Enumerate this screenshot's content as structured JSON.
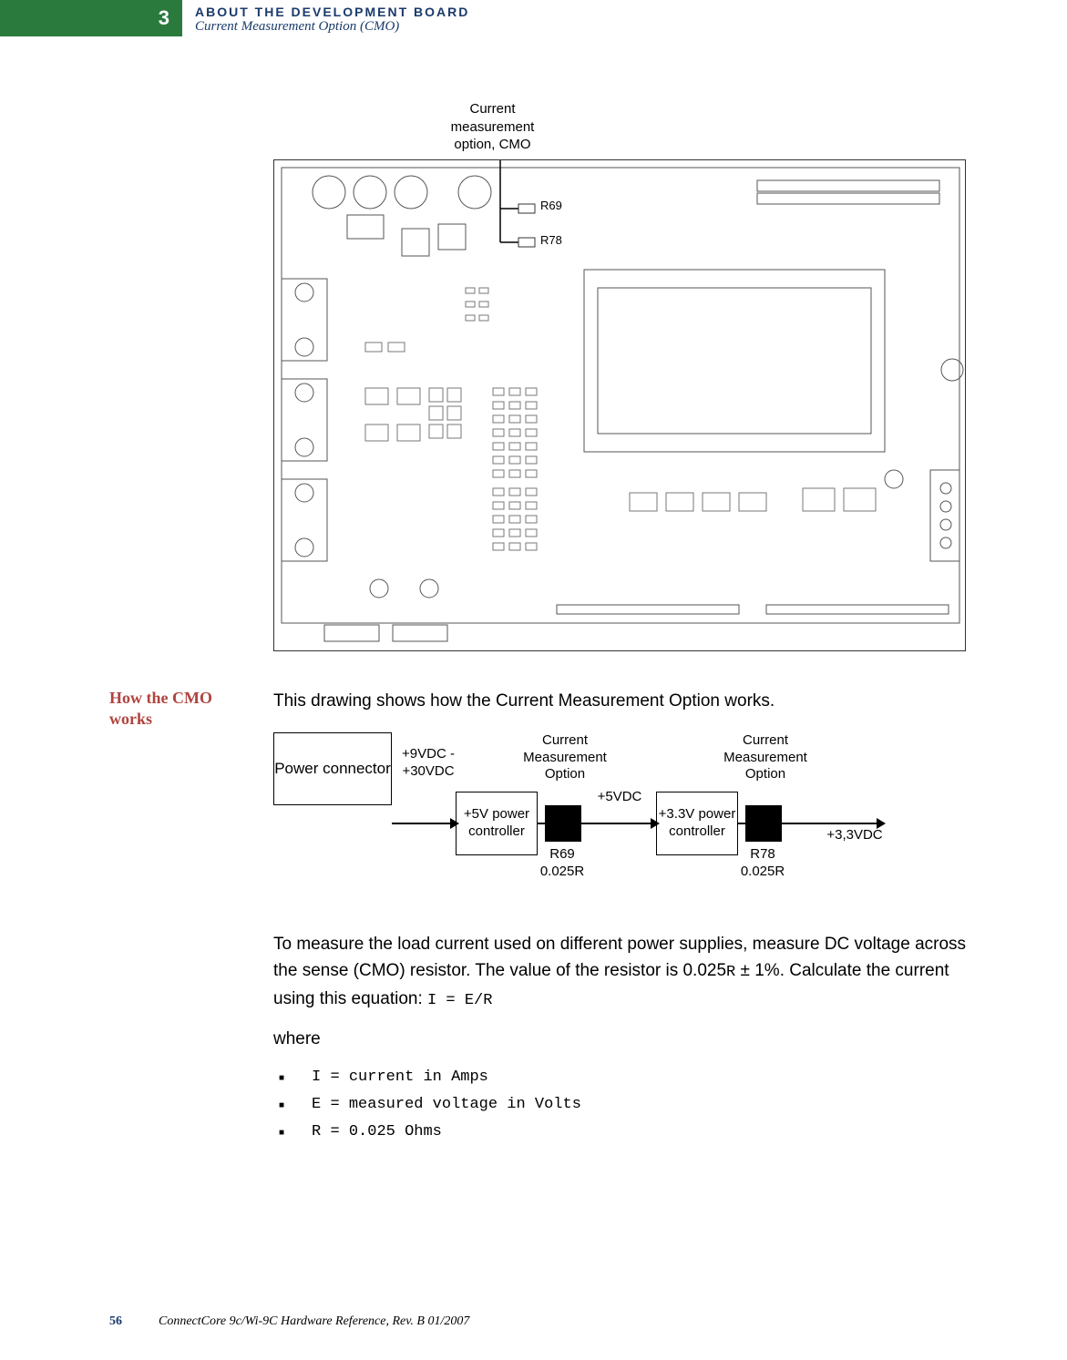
{
  "header": {
    "chapter_number": "3",
    "section_title": "ABOUT THE DEVELOPMENT BOARD",
    "section_subtitle": "Current Measurement Option (CMO)"
  },
  "pcb": {
    "caption_line1": "Current",
    "caption_line2": "measurement",
    "caption_line3": "option, CMO",
    "callout_r69": "R69",
    "callout_r78": "R78"
  },
  "section": {
    "label": "How the CMO works",
    "intro": "This drawing shows how the Current Measurement Option works."
  },
  "diagram": {
    "power_connector": "Power connector",
    "in_voltage": "+9VDC - +30VDC",
    "ctrl_5v": "+5V power controller",
    "cmo_title": "Current Measurement Option",
    "r69_name": "R69",
    "r69_value": "0.025R",
    "out_5v": "+5VDC",
    "ctrl_33v": "+3.3V power controller",
    "r78_name": "R78",
    "r78_value": "0.025R",
    "out_33v": "+3,3VDC"
  },
  "body": {
    "p1_a": "To measure the load current used on different power supplies, measure DC voltage across the sense (CMO) resistor. The value of the resistor is 0.025",
    "p1_b": " ± 1%. Calculate the current using this equation: ",
    "eqn": "I = E/R",
    "resistor_unit": "R",
    "where": "where",
    "defs": [
      "I = current in Amps",
      "E = measured voltage in Volts",
      "R = 0.025 Ohms"
    ]
  },
  "footer": {
    "page_number": "56",
    "reference": "ConnectCore 9c/Wi-9C Hardware Reference, Rev. B  01/2007"
  }
}
